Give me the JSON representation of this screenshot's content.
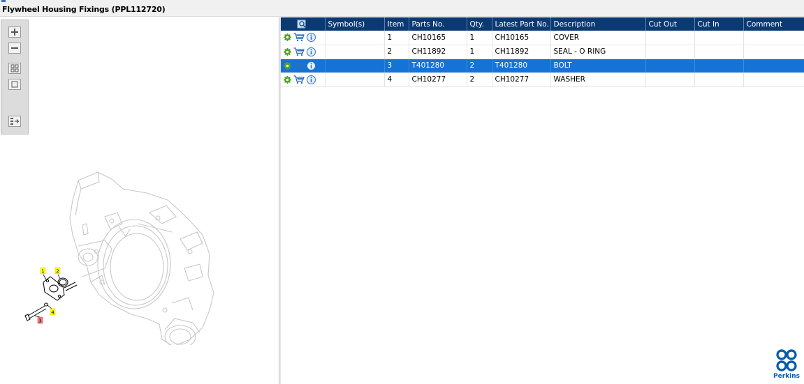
{
  "window": {
    "title": "Flywheel Housing Fixings (PPL112720)"
  },
  "toolbar": {
    "buttons": [
      "zoom-in",
      "zoom-out",
      "fit-all",
      "fit-window",
      "expand-list"
    ]
  },
  "drawing": {
    "callouts": [
      {
        "label": "1",
        "color": "#ffff00",
        "selected": false
      },
      {
        "label": "2",
        "color": "#ffff00",
        "selected": false
      },
      {
        "label": "3",
        "color": "#f08080",
        "selected": true
      },
      {
        "label": "4",
        "color": "#ffff00",
        "selected": false
      }
    ]
  },
  "table": {
    "columns": [
      "",
      "Symbol(s)",
      "Item",
      "Parts No.",
      "Qty.",
      "Latest Part No.",
      "Description",
      "Cut Out",
      "Cut In",
      "Comment"
    ],
    "rows": [
      {
        "symbol": "",
        "item": "1",
        "part_no": "CH10165",
        "qty": "1",
        "latest_part_no": "CH10165",
        "description": "COVER",
        "cut_out": "",
        "cut_in": "",
        "comment": "",
        "selected": false
      },
      {
        "symbol": "",
        "item": "2",
        "part_no": "CH11892",
        "qty": "1",
        "latest_part_no": "CH11892",
        "description": "SEAL - O RING",
        "cut_out": "",
        "cut_in": "",
        "comment": "",
        "selected": false
      },
      {
        "symbol": "",
        "item": "3",
        "part_no": "T401280",
        "qty": "2",
        "latest_part_no": "T401280",
        "description": "BOLT",
        "cut_out": "",
        "cut_in": "",
        "comment": "",
        "selected": true
      },
      {
        "symbol": "",
        "item": "4",
        "part_no": "CH10277",
        "qty": "2",
        "latest_part_no": "CH10277",
        "description": "WASHER",
        "cut_out": "",
        "cut_in": "",
        "comment": "",
        "selected": false
      }
    ]
  },
  "brand": {
    "name": "Perkins",
    "color": "#005bab"
  },
  "colors": {
    "header": "#0b3a73",
    "selection": "#1473d6",
    "gear": "#5aa02c",
    "cart": "#2d6fb8",
    "info": "#2f74c0"
  }
}
